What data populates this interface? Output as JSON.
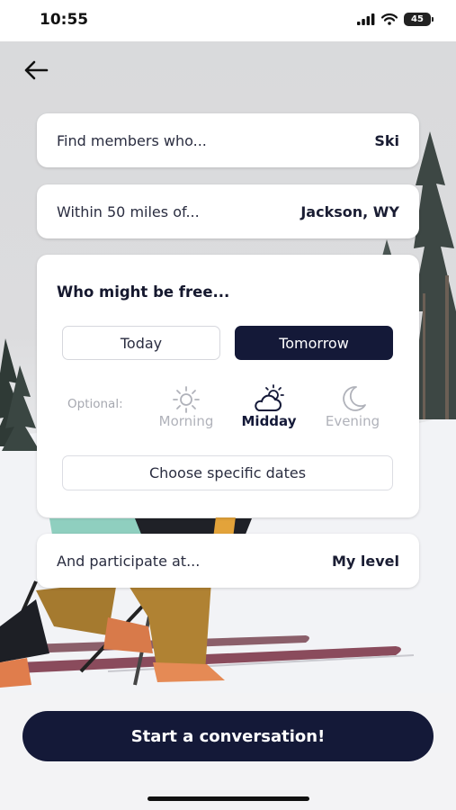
{
  "status": {
    "time": "10:55",
    "battery": "45"
  },
  "filters": {
    "activity": {
      "label": "Find members who...",
      "value": "Ski"
    },
    "location": {
      "label": "Within 50 miles of...",
      "value": "Jackson, WY"
    },
    "level": {
      "label": "And participate at...",
      "value": "My level"
    }
  },
  "availability": {
    "title": "Who might be free...",
    "days": [
      {
        "label": "Today",
        "selected": false
      },
      {
        "label": "Tomorrow",
        "selected": true
      }
    ],
    "optional_label": "Optional:",
    "times": [
      {
        "label": "Morning",
        "icon": "sun-icon",
        "selected": false
      },
      {
        "label": "Midday",
        "icon": "partly-cloudy-icon",
        "selected": true
      },
      {
        "label": "Evening",
        "icon": "moon-icon",
        "selected": false
      }
    ],
    "specific_dates_label": "Choose specific dates"
  },
  "cta": {
    "label": "Start a conversation!"
  },
  "colors": {
    "navy": "#141938",
    "muted": "#a6a8b0",
    "card": "#ffffff"
  }
}
